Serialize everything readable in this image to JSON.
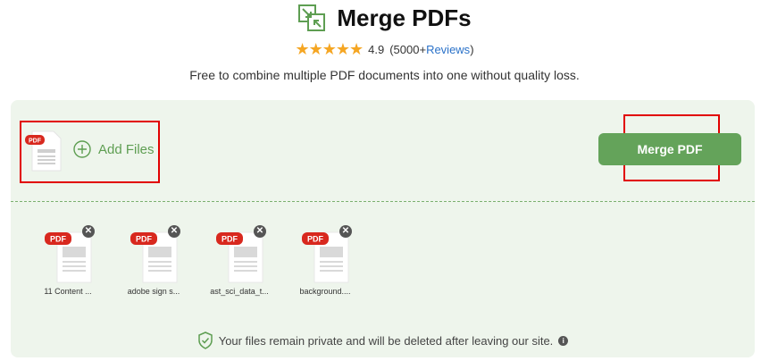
{
  "header": {
    "title": "Merge PDFs",
    "rating_value": "4.9",
    "rating_count_prefix": "(5000+",
    "rating_link": "Reviews",
    "rating_count_suffix": ")",
    "subtitle": "Free to combine multiple PDF documents into one without quality loss."
  },
  "toolbar": {
    "pdf_badge": "PDF",
    "add_files_label": "Add Files",
    "merge_label": "Merge PDF"
  },
  "files": [
    {
      "badge": "PDF",
      "name": "11 Content ..."
    },
    {
      "badge": "PDF",
      "name": "adobe sign s..."
    },
    {
      "badge": "PDF",
      "name": "ast_sci_data_t..."
    },
    {
      "badge": "PDF",
      "name": "background...."
    }
  ],
  "footer": {
    "privacy_text": "Your files remain private and will be deleted after leaving our site."
  },
  "colors": {
    "accent": "#64a35a",
    "panel_bg": "#eef5ec",
    "badge_red": "#d8281e",
    "star": "#f5a623",
    "link": "#2b72c9"
  },
  "icons": {
    "app": "merge-arrows-icon",
    "add": "plus-circle-icon",
    "file_remove": "close-icon",
    "privacy": "shield-check-icon",
    "info": "info-icon"
  }
}
